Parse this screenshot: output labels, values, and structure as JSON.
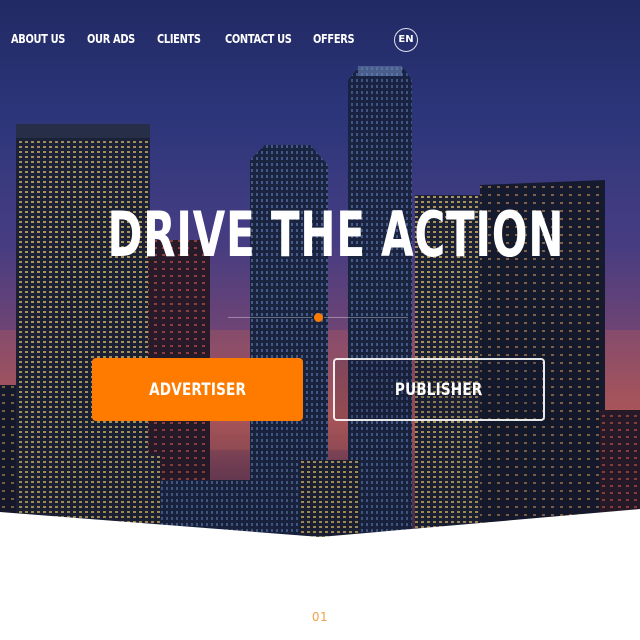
{
  "nav": {
    "items": [
      {
        "label": "ABOUT US"
      },
      {
        "label": "OUR ADS"
      },
      {
        "label": "CLIENTS"
      },
      {
        "label": "CONTACT US"
      },
      {
        "label": "OFFERS"
      }
    ],
    "language": "EN"
  },
  "hero": {
    "headline": "DRIVE THE ACTION",
    "buttons": {
      "advertiser": "ADVERTISER",
      "publisher": "PUBLISHER"
    }
  },
  "section": {
    "number": "01"
  },
  "colors": {
    "accent": "#ff7b00",
    "sky_top": "#27306e",
    "sky_bottom": "#b35b62",
    "section_number": "#f3a04a"
  }
}
